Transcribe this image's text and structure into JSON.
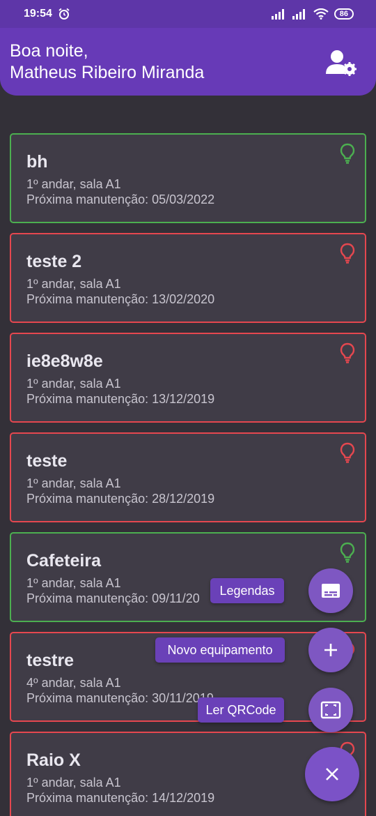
{
  "status_bar": {
    "time": "19:54",
    "battery": "86"
  },
  "header": {
    "greeting": "Boa noite,",
    "user_name": "Matheus Ribeiro Miranda"
  },
  "colors": {
    "ok": "#4caf50",
    "late": "#e5474f",
    "accent": "#673ab7"
  },
  "equipment": [
    {
      "name": "bh",
      "location": "1º andar, sala A1",
      "next_maintenance": "Próxima manutenção: 05/03/2022",
      "status": "ok"
    },
    {
      "name": "teste 2",
      "location": "1º andar, sala A1",
      "next_maintenance": "Próxima manutenção: 13/02/2020",
      "status": "late"
    },
    {
      "name": "ie8e8w8e",
      "location": "1º andar, sala A1",
      "next_maintenance": "Próxima manutenção: 13/12/2019",
      "status": "late"
    },
    {
      "name": "teste",
      "location": "1º andar, sala A1",
      "next_maintenance": "Próxima manutenção: 28/12/2019",
      "status": "late"
    },
    {
      "name": "Cafeteira",
      "location": "1º andar, sala A1",
      "next_maintenance": "Próxima manutenção: 09/11/20",
      "status": "ok"
    },
    {
      "name": "testre",
      "location": "4º andar, sala A1",
      "next_maintenance": "Próxima manutenção: 30/11/2019",
      "status": "late"
    },
    {
      "name": "Raio X",
      "location": "1º andar, sala A1",
      "next_maintenance": "Próxima manutenção: 14/12/2019",
      "status": "late"
    }
  ],
  "fab_menu": {
    "legend_label": "Legendas",
    "new_equipment_label": "Novo equipamento",
    "read_qr_label": "Ler QRCode"
  }
}
